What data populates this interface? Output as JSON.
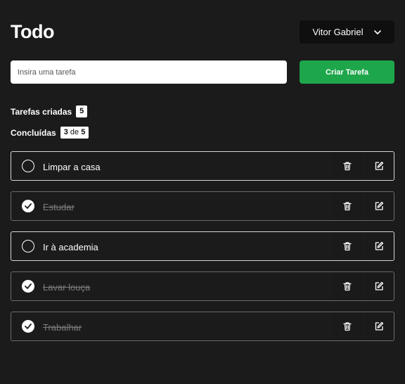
{
  "header": {
    "title": "Todo",
    "user_name": "Vitor Gabriel"
  },
  "new_task": {
    "placeholder": "Insira uma tarefa",
    "create_label": "Criar Tarefa"
  },
  "stats": {
    "created_label": "Tarefas criadas",
    "created_count": "5",
    "done_label": "Concluídas",
    "done_count": "3",
    "done_sep": "de",
    "done_total": "5"
  },
  "tasks": [
    {
      "text": "Limpar a casa",
      "done": false
    },
    {
      "text": "Estudar",
      "done": true
    },
    {
      "text": "Ir à academia",
      "done": false
    },
    {
      "text": "Lavar louça",
      "done": true
    },
    {
      "text": "Trabalhar",
      "done": true
    }
  ],
  "colors": {
    "background": "#1b1b1b",
    "accent": "#1ea64b",
    "completed_text": "#7a7a7a"
  },
  "icons": {
    "dropdown": "chevron-down-icon",
    "delete": "trash-icon",
    "edit": "edit-icon",
    "checked": "check-icon"
  }
}
